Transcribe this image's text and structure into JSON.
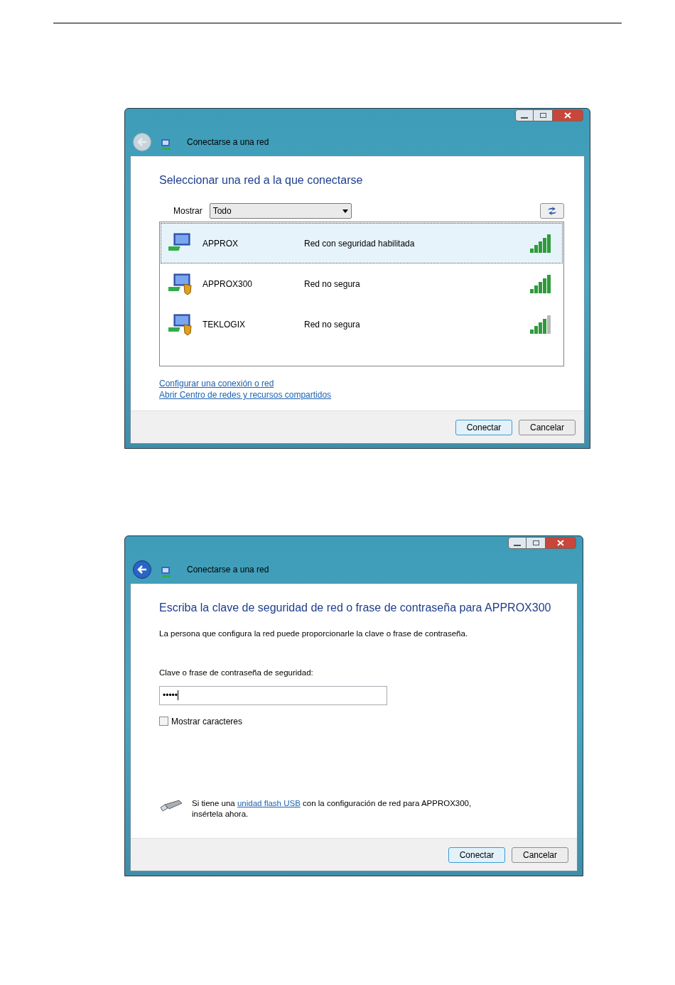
{
  "windows": [
    {
      "title": "Conectarse a una red",
      "back_enabled": false,
      "kind": "network_list",
      "heading": "Seleccionar una red a la que conectarse",
      "show_label": "Mostrar",
      "show_value": "Todo",
      "networks": [
        {
          "name": "APPROX",
          "status": "Red con seguridad habilitada",
          "warning": false,
          "level": 1,
          "selected": true
        },
        {
          "name": "APPROX300",
          "status": "Red no segura",
          "warning": true,
          "level": 1,
          "selected": false
        },
        {
          "name": "TEKLOGIX",
          "status": "Red no segura",
          "warning": true,
          "level": 0.8,
          "selected": false
        }
      ],
      "links": [
        "Configurar una conexión o red",
        "Abrir Centro de redes y recursos compartidos"
      ],
      "buttons": [
        {
          "label": "Conectar",
          "default": true
        },
        {
          "label": "Cancelar",
          "default": false
        }
      ]
    },
    {
      "title": "Conectarse a una red",
      "back_enabled": true,
      "kind": "password",
      "heading": "Escriba la clave de seguridad de red o frase de contraseña para APPROX300",
      "description": "La persona que configura la red puede proporcionarle la clave o frase de contraseña.",
      "field_label": "Clave o frase de contraseña de seguridad:",
      "field_value": "•••••",
      "checkbox": {
        "label": "Mostrar caracteres",
        "checked": false
      },
      "usb_before": "Si tiene una",
      "usb_link": "unidad flash USB",
      "usb_after": "con la configuración de red para APPROX300, insértela ahora.",
      "buttons": [
        {
          "label": "Conectar",
          "default": true
        },
        {
          "label": "Cancelar",
          "default": false
        }
      ]
    }
  ]
}
